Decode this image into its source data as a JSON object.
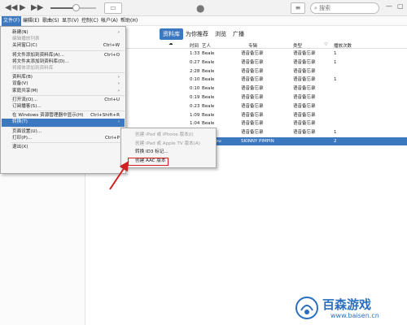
{
  "toolbar": {
    "rewind_icon": "rewind-icon",
    "play_icon": "play-icon",
    "forward_icon": "fast-forward-icon",
    "volume_level": 0.55,
    "search_placeholder": "搜索",
    "list_icon": "list-icon"
  },
  "menubar": [
    "文件(F)",
    "编辑(E)",
    "歌曲(S)",
    "显示(V)",
    "控制(C)",
    "帐户(A)",
    "帮助(H)"
  ],
  "tabs": [
    "资料库",
    "为你推荐",
    "浏览",
    "广播"
  ],
  "table": {
    "headers": [
      "时间",
      "艺人",
      "专辑",
      "类型",
      "播放次数"
    ],
    "rows": [
      {
        "time": "1:33",
        "artist": "Beale",
        "album": "语音备忘录",
        "genre": "语音备忘录",
        "plays": "1"
      },
      {
        "time": "0:27",
        "artist": "Beale",
        "album": "语音备忘录",
        "genre": "语音备忘录",
        "plays": "1"
      },
      {
        "time": "2:28",
        "artist": "Beale",
        "album": "语音备忘录",
        "genre": "语音备忘录",
        "plays": ""
      },
      {
        "time": "0:10",
        "artist": "Beale",
        "album": "语音备忘录",
        "genre": "语音备忘录",
        "plays": "1"
      },
      {
        "time": "0:10",
        "artist": "Beale",
        "album": "语音备忘录",
        "genre": "语音备忘录",
        "plays": ""
      },
      {
        "time": "0:19",
        "artist": "Beale",
        "album": "语音备忘录",
        "genre": "语音备忘录",
        "plays": ""
      },
      {
        "time": "0:23",
        "artist": "Beale",
        "album": "语音备忘录",
        "genre": "语音备忘录",
        "plays": ""
      },
      {
        "time": "1:09",
        "artist": "Beale",
        "album": "语音备忘录",
        "genre": "语音备忘录",
        "plays": ""
      },
      {
        "time": "1:04",
        "artist": "Beale",
        "album": "语音备忘录",
        "genre": "语音备忘录",
        "plays": ""
      },
      {
        "time": "",
        "artist": "Beale",
        "album": "语音备忘录",
        "genre": "语音备忘录",
        "plays": "1"
      },
      {
        "time": "",
        "artist": "J/lipoqou",
        "album": "SKINNY PIMPIN",
        "genre": "",
        "plays": "2",
        "selected": true
      }
    ]
  },
  "file_menu": [
    {
      "label": "新建(N)",
      "shortcut": "",
      "arrow": true
    },
    {
      "label": "编辑播放列表",
      "disabled": true
    },
    {
      "label": "关闭窗口(C)",
      "shortcut": "Ctrl+W"
    },
    {
      "sep": true
    },
    {
      "label": "将文件添加到资料库(A)...",
      "shortcut": "Ctrl+O"
    },
    {
      "label": "将文件夹添加到资料库(D)...",
      "shortcut": ""
    },
    {
      "label": "将媒体添加到资料库",
      "disabled": true
    },
    {
      "sep": true
    },
    {
      "label": "资料库(B)",
      "arrow": true
    },
    {
      "label": "设备(V)",
      "arrow": true
    },
    {
      "label": "家庭共享(M)",
      "arrow": true
    },
    {
      "sep": true
    },
    {
      "label": "打开流(O)...",
      "shortcut": "Ctrl+U"
    },
    {
      "label": "订阅播客(S)...",
      "shortcut": ""
    },
    {
      "sep": true
    },
    {
      "label": "在 Windows 资源管理器中显示(H)",
      "shortcut": "Ctrl+Shift+R"
    },
    {
      "label": "转换(T)",
      "arrow": true,
      "highlight": true
    },
    {
      "sep": true
    },
    {
      "label": "页面设置(U)..."
    },
    {
      "label": "打印(P)...",
      "shortcut": "Ctrl+P"
    },
    {
      "sep": true
    },
    {
      "label": "退出(X)"
    }
  ],
  "convert_submenu": [
    {
      "label": "创建 iPod 或 iPhone 版本(I)",
      "disabled": true
    },
    {
      "label": "创建 iPad 或 Apple TV 版本(A)",
      "disabled": true
    },
    {
      "label": "转换 ID3 标记...",
      "disabled": false
    },
    {
      "label": "创建 AAC 版本",
      "disabled": false
    }
  ],
  "watermark": {
    "brand": "百森游戏",
    "url": "www.baisen.cn"
  },
  "colors": {
    "accent": "#3b78c0",
    "annotation": "#d02020"
  }
}
